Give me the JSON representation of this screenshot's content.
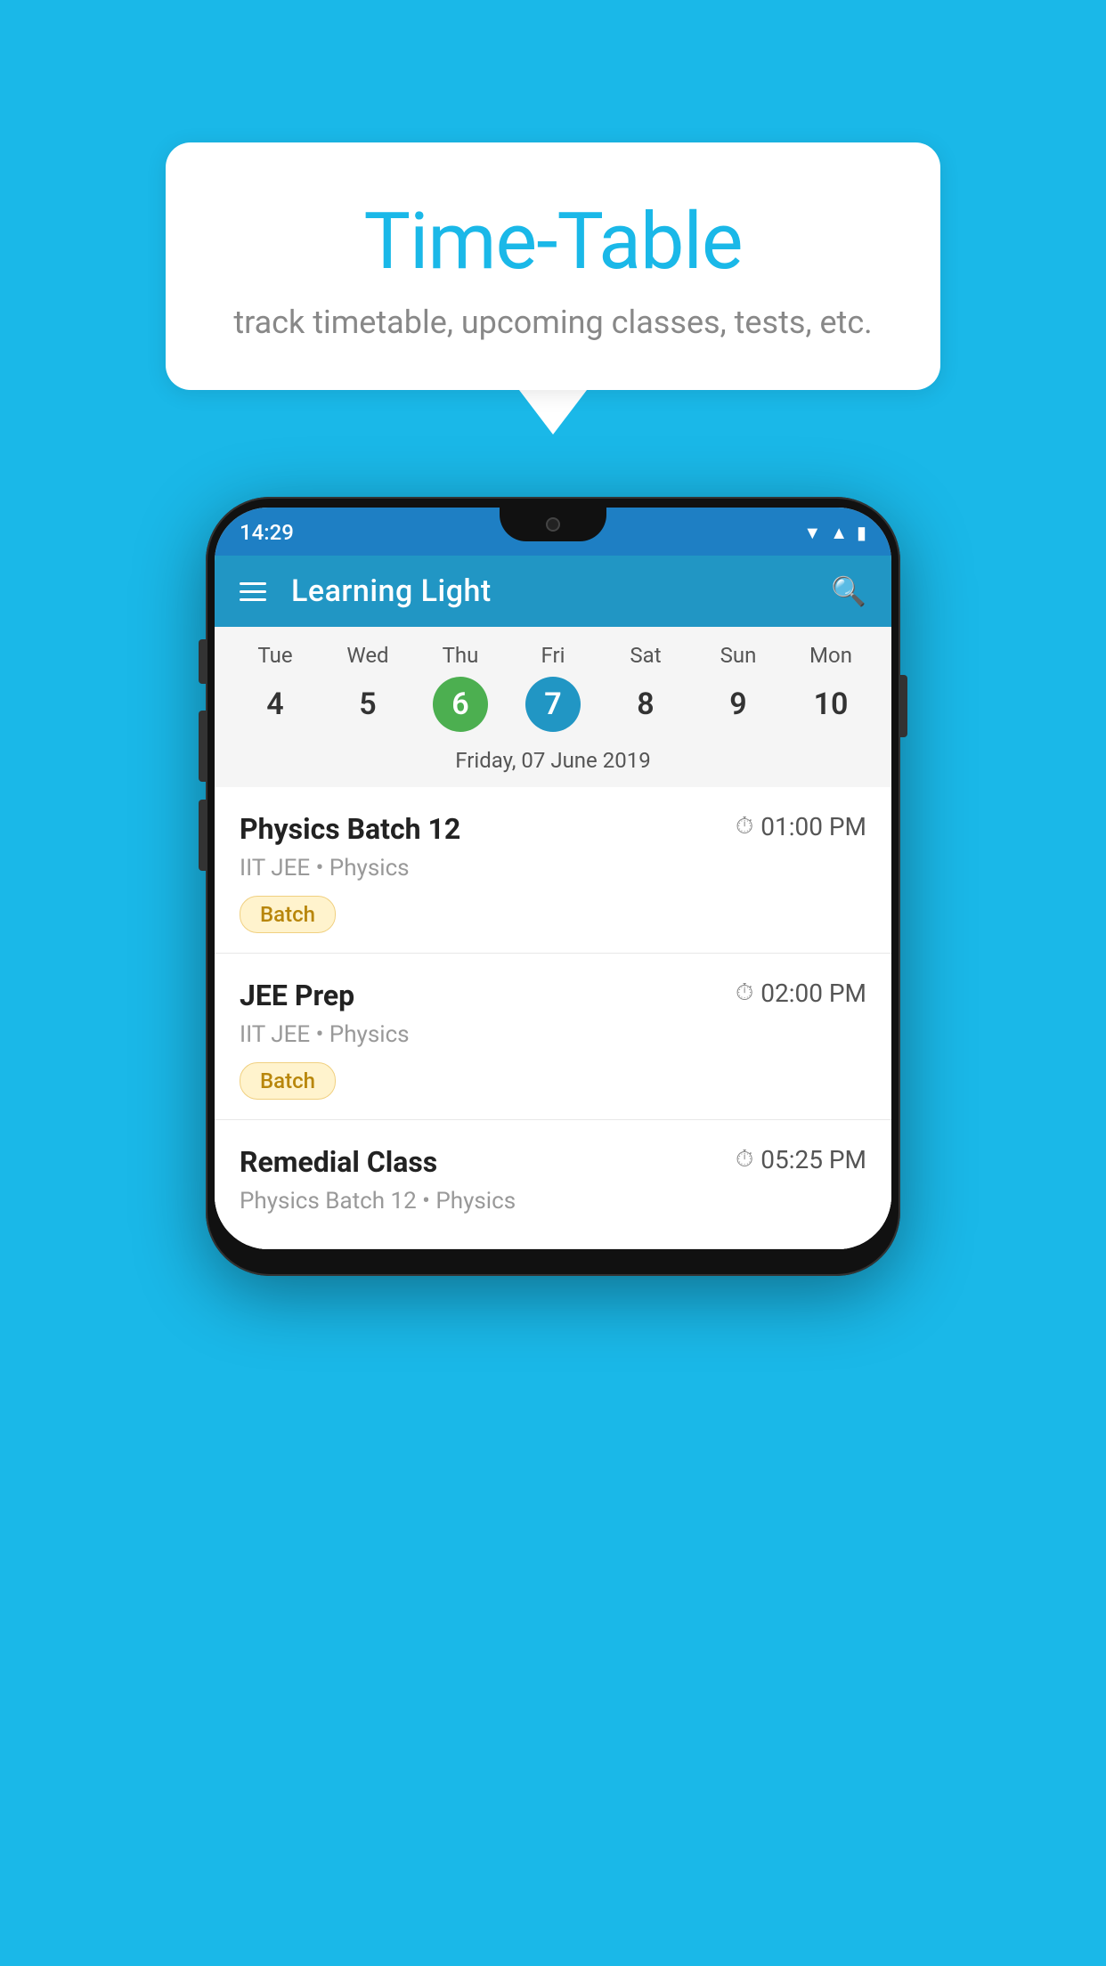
{
  "background_color": "#1AB8E8",
  "speech_bubble": {
    "title": "Time-Table",
    "subtitle": "track timetable, upcoming classes, tests, etc."
  },
  "phone": {
    "status_bar": {
      "time": "14:29",
      "icons": [
        "wifi",
        "signal",
        "battery"
      ]
    },
    "app_bar": {
      "title": "Learning Light"
    },
    "calendar": {
      "days": [
        {
          "name": "Tue",
          "num": "4",
          "state": "normal"
        },
        {
          "name": "Wed",
          "num": "5",
          "state": "normal"
        },
        {
          "name": "Thu",
          "num": "6",
          "state": "today"
        },
        {
          "name": "Fri",
          "num": "7",
          "state": "selected"
        },
        {
          "name": "Sat",
          "num": "8",
          "state": "normal"
        },
        {
          "name": "Sun",
          "num": "9",
          "state": "normal"
        },
        {
          "name": "Mon",
          "num": "10",
          "state": "normal"
        }
      ],
      "selected_date_label": "Friday, 07 June 2019"
    },
    "classes": [
      {
        "name": "Physics Batch 12",
        "time": "01:00 PM",
        "meta": "IIT JEE • Physics",
        "badge": "Batch"
      },
      {
        "name": "JEE Prep",
        "time": "02:00 PM",
        "meta": "IIT JEE • Physics",
        "badge": "Batch"
      },
      {
        "name": "Remedial Class",
        "time": "05:25 PM",
        "meta": "Physics Batch 12 • Physics",
        "badge": null
      }
    ]
  }
}
